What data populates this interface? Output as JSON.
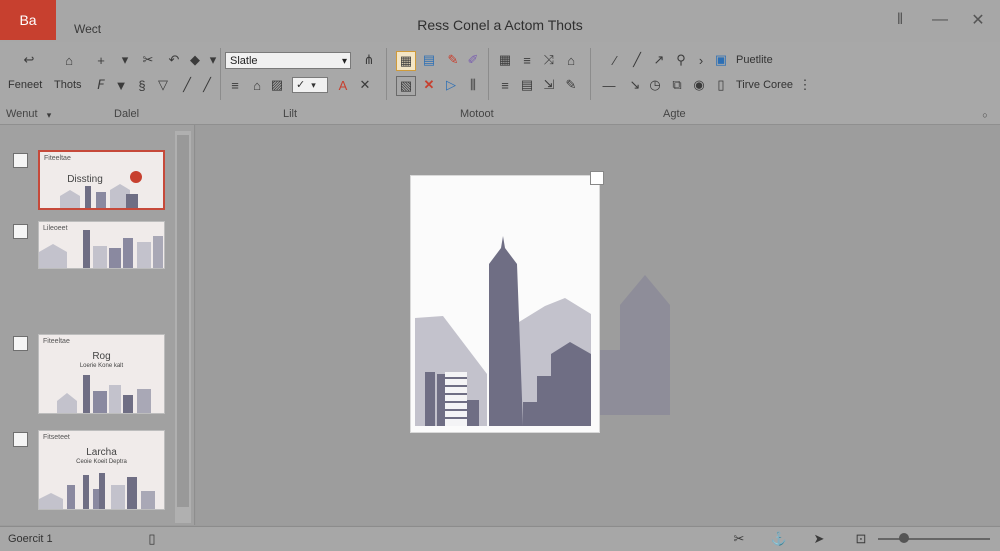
{
  "app": {
    "badge": "Ba",
    "quick_access": "Wect",
    "title": "Ress Conel a Actom Thots"
  },
  "ribbon": {
    "left_labels": {
      "first": "Feneet",
      "second": "Thots"
    },
    "style_combo": "Slatle",
    "right_buttons": {
      "top": "Puetlite",
      "bottom": "Tirve Coree"
    },
    "groups": [
      "Wenut",
      "Dalel",
      "Lilt",
      "Motoot",
      "Agte"
    ]
  },
  "slides": [
    {
      "header": "Fiteeltae",
      "title": "Dissting",
      "selected": true
    },
    {
      "header": "Lileoeet",
      "title": "",
      "selected": false
    },
    {
      "header": "Fiteeltae",
      "title": "Rog",
      "subtitle": "Loerie Kone kalt",
      "selected": false
    },
    {
      "header": "Fitseteet",
      "title": "Larcha",
      "subtitle": "Ceoie Koeit Deptra",
      "selected": false
    }
  ],
  "status": {
    "left": "Goercit 1"
  },
  "colors": {
    "accent": "#c7402f",
    "skyline_dark": "#6f6e84",
    "skyline_light": "#c3c2cc"
  },
  "icons": [
    "back-arrow-icon",
    "home-icon",
    "plus-icon",
    "filter-icon",
    "cut-icon",
    "brush-icon",
    "paint-icon",
    "pen-icon",
    "align-icon",
    "check-icon",
    "close-x-icon",
    "play-icon",
    "grid-icon",
    "list-icon",
    "draw-icon",
    "zoom-icon",
    "expand-icon",
    "cursor-icon",
    "fit-icon"
  ]
}
